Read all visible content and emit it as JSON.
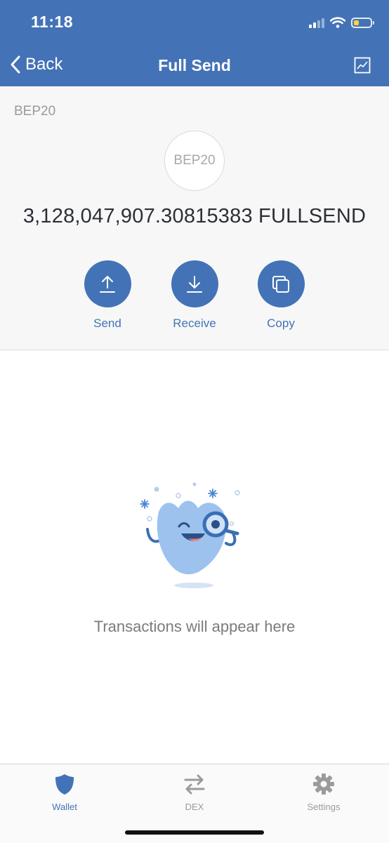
{
  "status_bar": {
    "time": "11:18"
  },
  "nav": {
    "back_label": "Back",
    "title": "Full Send"
  },
  "token": {
    "network": "BEP20",
    "logo_text": "BEP20",
    "balance": "3,128,047,907.30815383 FULLSEND"
  },
  "actions": [
    {
      "label": "Send",
      "icon": "upload-arrow-icon"
    },
    {
      "label": "Receive",
      "icon": "download-arrow-icon"
    },
    {
      "label": "Copy",
      "icon": "copy-icon"
    }
  ],
  "transactions": {
    "empty_message": "Transactions will appear here"
  },
  "tabbar": {
    "items": [
      {
        "label": "Wallet",
        "icon": "shield-icon",
        "active": true
      },
      {
        "label": "DEX",
        "icon": "swap-arrows-icon",
        "active": false
      },
      {
        "label": "Settings",
        "icon": "gear-icon",
        "active": false
      }
    ]
  },
  "colors": {
    "brand": "#4373b6",
    "battery_level": "#ffd23f"
  }
}
